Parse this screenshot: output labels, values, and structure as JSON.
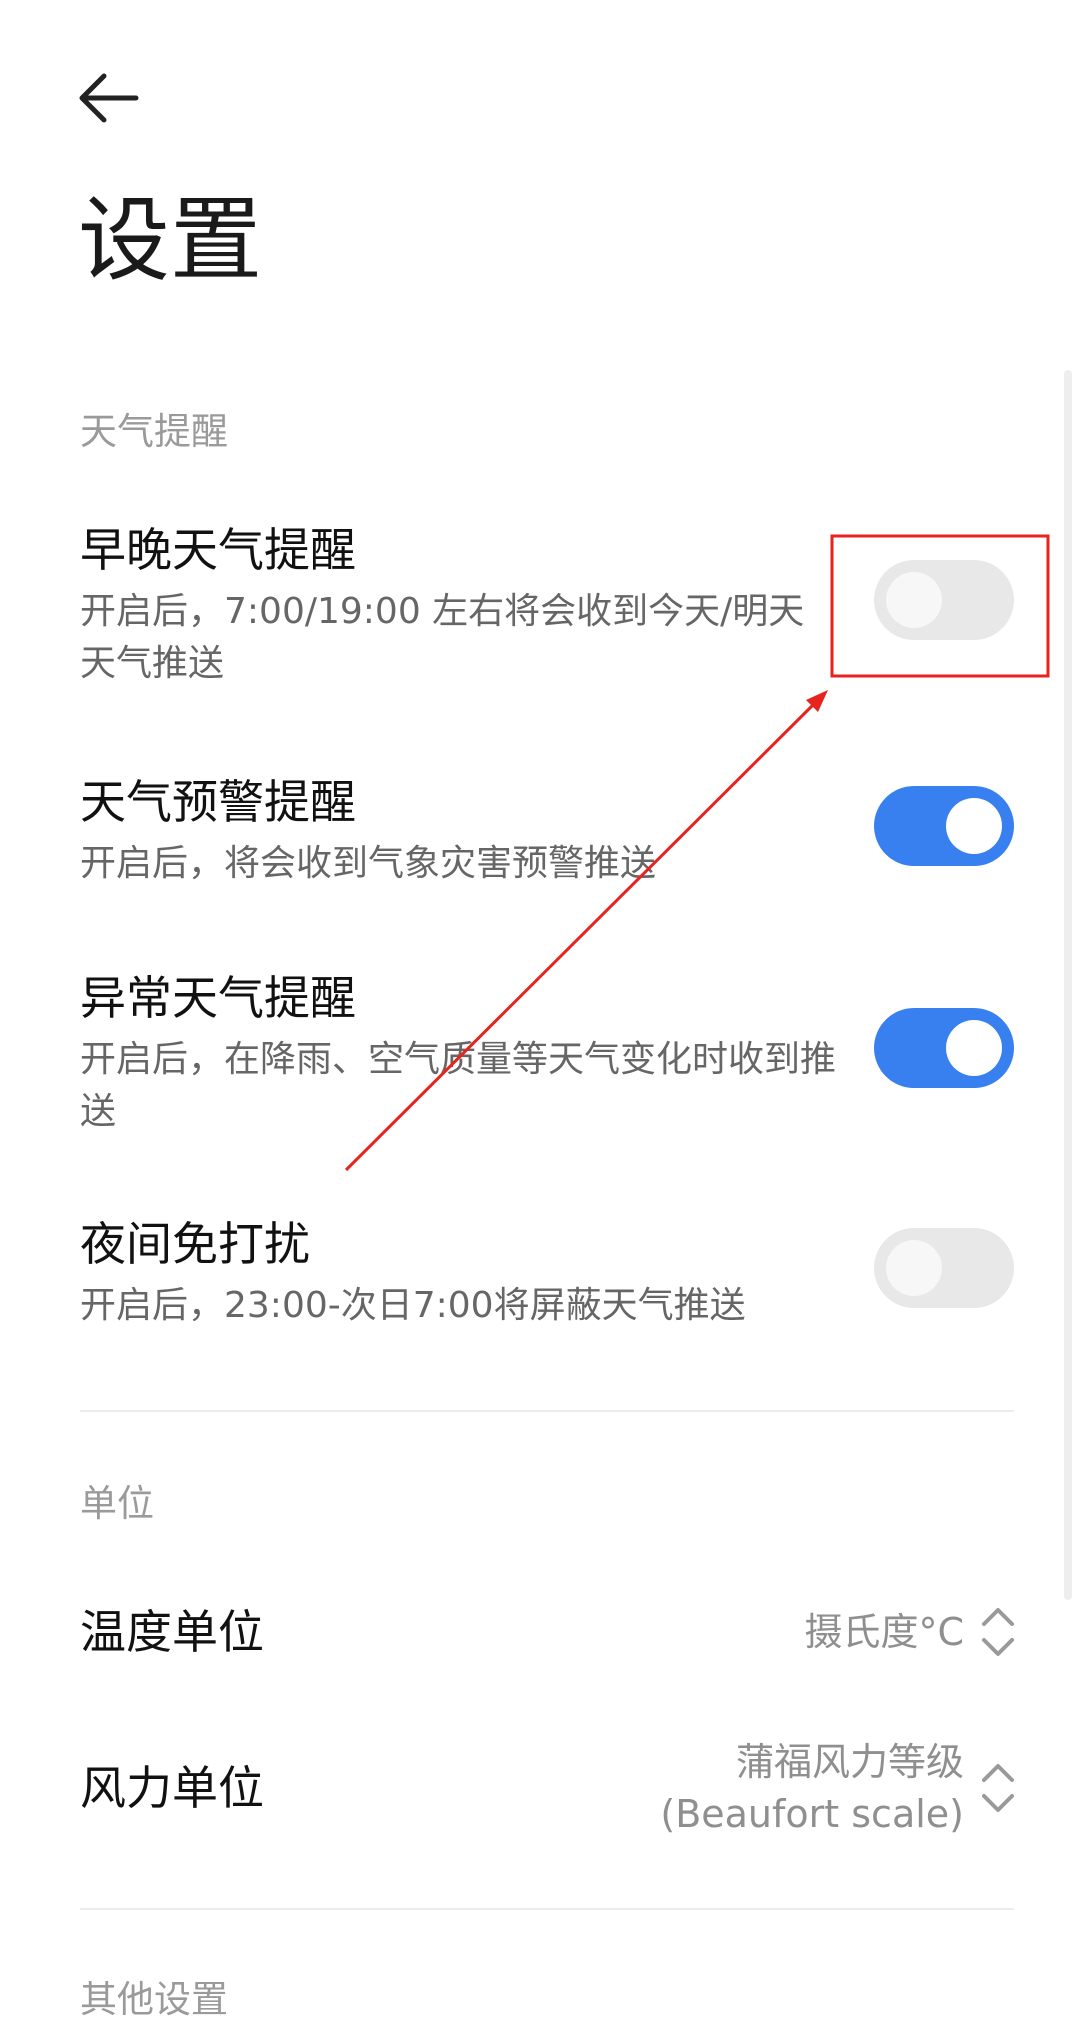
{
  "header": {
    "back_icon": "arrow-left-icon",
    "title": "设置"
  },
  "sections": {
    "weather_reminder": {
      "label": "天气提醒",
      "items": [
        {
          "title": "早晚天气提醒",
          "desc": "开启后，7:00/19:00 左右将会收到今天/明天天气推送",
          "enabled": false
        },
        {
          "title": "天气预警提醒",
          "desc": "开启后，将会收到气象灾害预警推送",
          "enabled": true
        },
        {
          "title": "异常天气提醒",
          "desc": "开启后，在降雨、空气质量等天气变化时收到推送",
          "enabled": true
        },
        {
          "title": "夜间免打扰",
          "desc": "开启后，23:00-次日7:00将屏蔽天气推送",
          "enabled": false
        }
      ]
    },
    "units": {
      "label": "单位",
      "temperature": {
        "title": "温度单位",
        "value": "摄氏度°C"
      },
      "wind": {
        "title": "风力单位",
        "value_line1": "蒲福风力等级",
        "value_line2": "(Beaufort scale)"
      }
    },
    "other": {
      "label": "其他设置"
    }
  },
  "colors": {
    "accent": "#3880f0",
    "toggle_off": "#e8e8e8",
    "annotation_red": "#e8231f"
  }
}
